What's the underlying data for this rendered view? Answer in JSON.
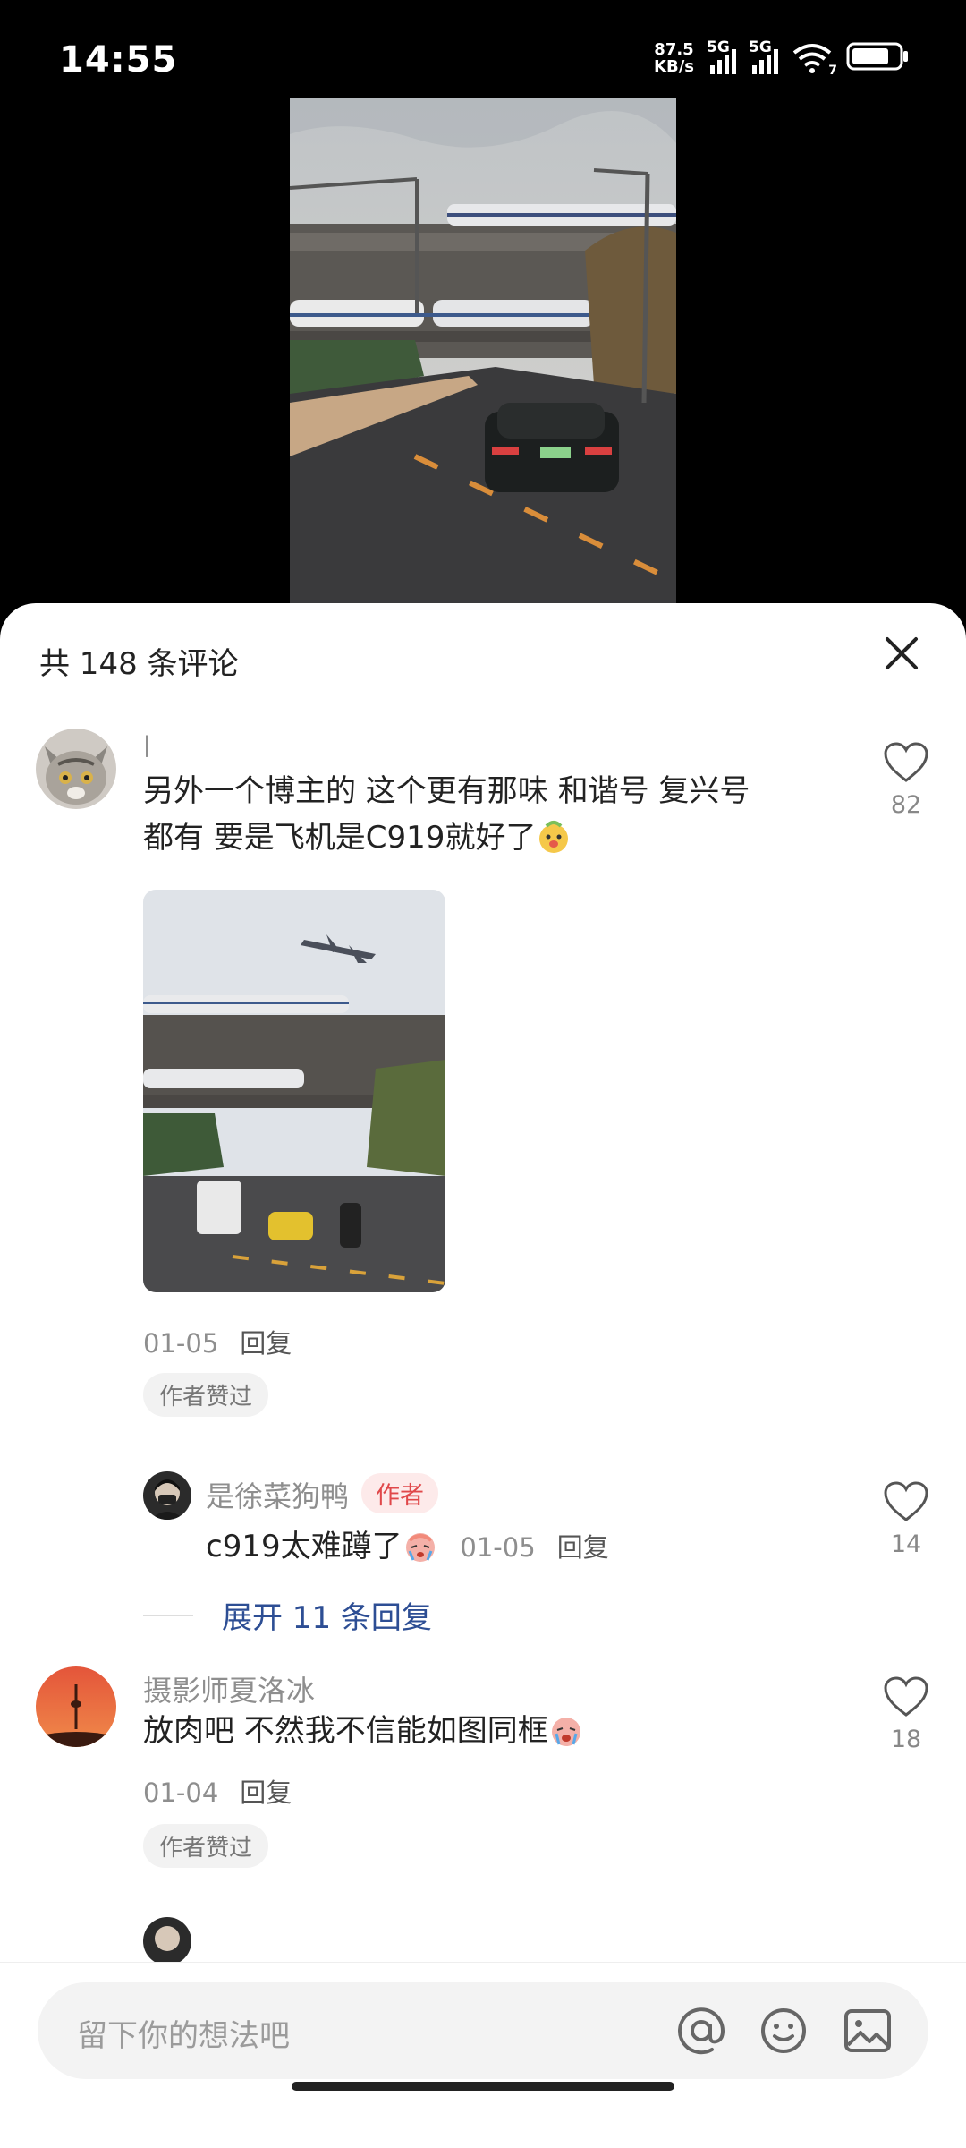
{
  "status_bar": {
    "time": "14:55",
    "net_speed_value": "87.5",
    "net_speed_unit": "KB/s",
    "sim1": "5G",
    "sim2": "5G",
    "wifi_badge": "7"
  },
  "sheet": {
    "title": "共 148 条评论"
  },
  "comments": [
    {
      "username": "l",
      "text_line1": "另外一个博主的 这个更有那味 和谐号 复兴号",
      "text_line2": "都有 要是飞机是C919就好了",
      "date": "01-05",
      "reply_label": "回复",
      "liked_by_author": "作者赞过",
      "likes": "82",
      "reply": {
        "username": "是徐菜狗鸭",
        "author_tag": "作者",
        "text": "c919太难蹲了",
        "date": "01-05",
        "reply_label": "回复",
        "likes": "14"
      },
      "expand_label": "展开 11 条回复"
    },
    {
      "username": "摄影师夏洛冰",
      "text": "放肉吧 不然我不信能如图同框",
      "date": "01-04",
      "reply_label": "回复",
      "liked_by_author": "作者赞过",
      "likes": "18"
    }
  ],
  "input": {
    "placeholder": "留下你的想法吧"
  },
  "icons": [
    "close-icon",
    "heart-icon",
    "at-icon",
    "smiley-icon",
    "image-icon",
    "wifi-icon",
    "battery-icon",
    "signal-icon"
  ]
}
